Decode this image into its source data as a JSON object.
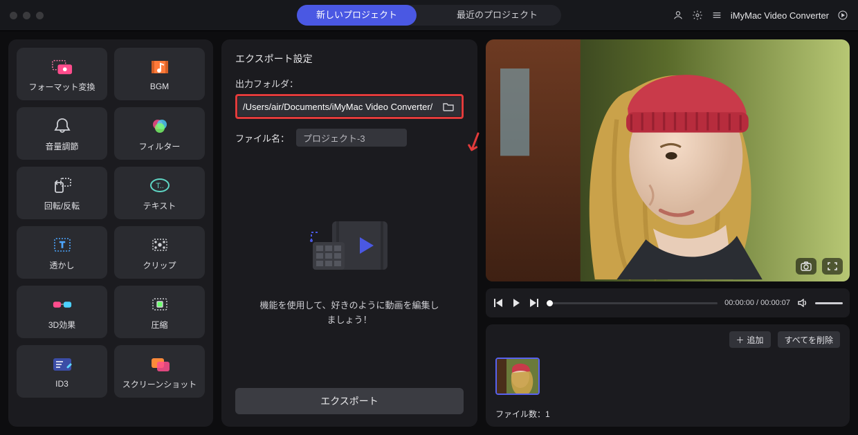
{
  "app": {
    "name": "iMyMac Video Converter"
  },
  "titlebar": {
    "tabs": {
      "new_project": "新しいプロジェクト",
      "recent_projects": "最近のプロジェクト"
    }
  },
  "tools": [
    {
      "id": "format",
      "label": "フォーマット変換"
    },
    {
      "id": "bgm",
      "label": "BGM"
    },
    {
      "id": "volume",
      "label": "音量調節"
    },
    {
      "id": "filter",
      "label": "フィルター"
    },
    {
      "id": "rotate",
      "label": "回転/反転"
    },
    {
      "id": "text",
      "label": "テキスト"
    },
    {
      "id": "watermark",
      "label": "透かし"
    },
    {
      "id": "clip",
      "label": "クリップ"
    },
    {
      "id": "effect3d",
      "label": "3D効果"
    },
    {
      "id": "compress",
      "label": "圧縮"
    },
    {
      "id": "id3",
      "label": "ID3"
    },
    {
      "id": "screenshot",
      "label": "スクリーンショット"
    }
  ],
  "export_panel": {
    "title": "エクスポート設定",
    "output_folder_label": "出力フォルダ：",
    "output_path": "/Users/air/Documents/iMyMac Video Converter/",
    "file_name_label": "ファイル名：",
    "file_name_value": "プロジェクト-3",
    "hint": "機能を使用して、好きのように動画を編集しましょう！",
    "export_button": "エクスポート"
  },
  "player": {
    "time_current": "00:00:00",
    "time_total": "00:00:07"
  },
  "file_panel": {
    "add_button": "追加",
    "clear_button": "すべてを削除",
    "file_count_label": "ファイル数：",
    "file_count_value": "1"
  }
}
